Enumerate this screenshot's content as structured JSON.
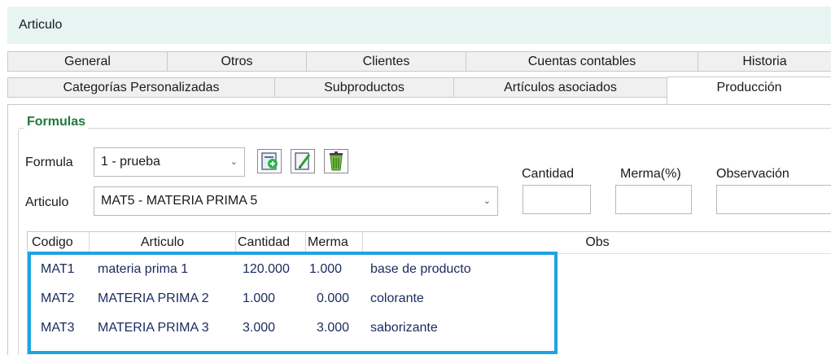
{
  "window": {
    "title": "Articulo"
  },
  "tabs_row1": [
    {
      "label": "General"
    },
    {
      "label": "Otros"
    },
    {
      "label": "Clientes"
    },
    {
      "label": "Cuentas contables"
    },
    {
      "label": "Historia"
    }
  ],
  "tabs_row2": [
    {
      "label": "Categorías Personalizadas"
    },
    {
      "label": "Subproductos"
    },
    {
      "label": "Artículos asociados"
    },
    {
      "label": "Producción",
      "active": true
    }
  ],
  "group": {
    "title": "Formulas"
  },
  "form": {
    "formula_label": "Formula",
    "formula_value": "1 - prueba",
    "articulo_label": "Articulo",
    "articulo_value": "MAT5 - MATERIA PRIMA 5",
    "cantidad_label": "Cantidad",
    "merma_label": "Merma(%)",
    "observacion_label": "Observación",
    "cantidad_value": "",
    "merma_value": "",
    "observacion_value": ""
  },
  "icons": {
    "new": "new-formula-icon",
    "edit": "edit-formula-icon",
    "delete": "delete-formula-icon"
  },
  "grid": {
    "columns": [
      "Codigo",
      "Articulo",
      "Cantidad",
      "Merma",
      "Obs"
    ],
    "rows": [
      [
        "MAT1",
        "materia prima 1",
        "120.000",
        "1.000",
        "base de producto"
      ],
      [
        "MAT2",
        "MATERIA PRIMA 2",
        "1.000",
        "0.000",
        "colorante"
      ],
      [
        "MAT3",
        "MATERIA PRIMA 3",
        "3.000",
        "3.000",
        "saborizante"
      ]
    ]
  },
  "colors": {
    "title_bar": "#e6f4f2",
    "group_title": "#1f7a3a",
    "highlight": "#1fa3e0",
    "cell_text": "#1a2a5e"
  }
}
